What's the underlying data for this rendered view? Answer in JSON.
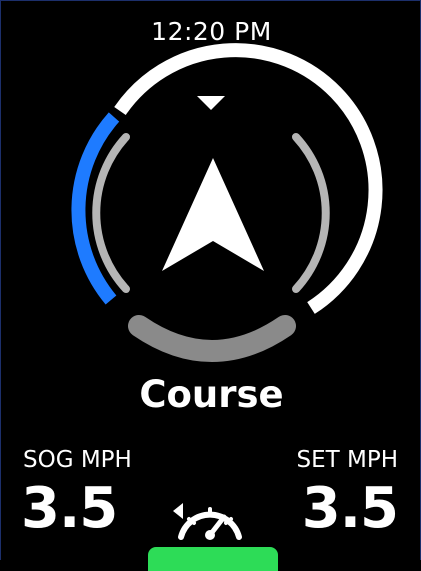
{
  "status": {
    "time": "12:20 PM"
  },
  "compass": {
    "mode_label": "Course",
    "colors": {
      "outer_ring": "#ffffff",
      "accent_arc": "#1e7bff",
      "inner_ticks": "#b5b5b5",
      "bottom_arc": "#8a8a8a",
      "arrow": "#ffffff"
    }
  },
  "readouts": {
    "sog": {
      "label": "SOG MPH",
      "value": "3.5"
    },
    "set": {
      "label": "SET MPH",
      "value": "3.5"
    }
  },
  "controls": {
    "speed_mode_icon": "speedometer-icon",
    "engage_color": "#2ddc57"
  }
}
